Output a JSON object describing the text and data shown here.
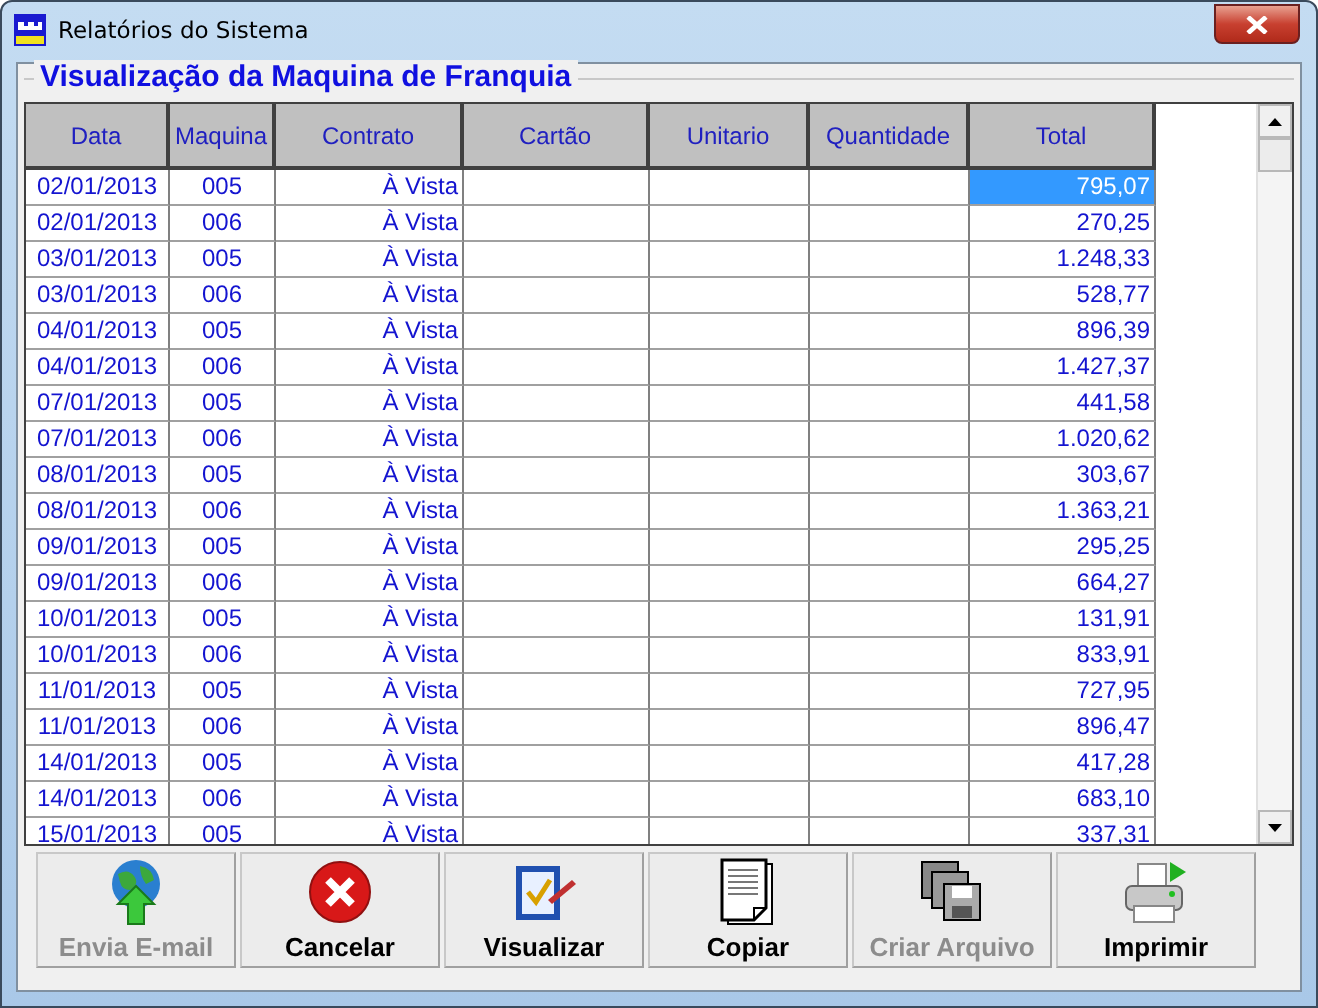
{
  "window": {
    "title": "Relatórios do Sistema"
  },
  "group": {
    "title": "Visualização da Maquina de Franquia"
  },
  "table": {
    "columns": [
      "Data",
      "Maquina",
      "Contrato",
      "Cartão",
      "Unitario",
      "Quantidade",
      "Total"
    ],
    "rows": [
      {
        "cells": [
          "02/01/2013",
          "005",
          "À Vista",
          "",
          "",
          "",
          "795,07"
        ],
        "selected": true
      },
      {
        "cells": [
          "02/01/2013",
          "006",
          "À Vista",
          "",
          "",
          "",
          "270,25"
        ],
        "selected": false
      },
      {
        "cells": [
          "03/01/2013",
          "005",
          "À Vista",
          "",
          "",
          "",
          "1.248,33"
        ],
        "selected": false
      },
      {
        "cells": [
          "03/01/2013",
          "006",
          "À Vista",
          "",
          "",
          "",
          "528,77"
        ],
        "selected": false
      },
      {
        "cells": [
          "04/01/2013",
          "005",
          "À Vista",
          "",
          "",
          "",
          "896,39"
        ],
        "selected": false
      },
      {
        "cells": [
          "04/01/2013",
          "006",
          "À Vista",
          "",
          "",
          "",
          "1.427,37"
        ],
        "selected": false
      },
      {
        "cells": [
          "07/01/2013",
          "005",
          "À Vista",
          "",
          "",
          "",
          "441,58"
        ],
        "selected": false
      },
      {
        "cells": [
          "07/01/2013",
          "006",
          "À Vista",
          "",
          "",
          "",
          "1.020,62"
        ],
        "selected": false
      },
      {
        "cells": [
          "08/01/2013",
          "005",
          "À Vista",
          "",
          "",
          "",
          "303,67"
        ],
        "selected": false
      },
      {
        "cells": [
          "08/01/2013",
          "006",
          "À Vista",
          "",
          "",
          "",
          "1.363,21"
        ],
        "selected": false
      },
      {
        "cells": [
          "09/01/2013",
          "005",
          "À Vista",
          "",
          "",
          "",
          "295,25"
        ],
        "selected": false
      },
      {
        "cells": [
          "09/01/2013",
          "006",
          "À Vista",
          "",
          "",
          "",
          "664,27"
        ],
        "selected": false
      },
      {
        "cells": [
          "10/01/2013",
          "005",
          "À Vista",
          "",
          "",
          "",
          "131,91"
        ],
        "selected": false
      },
      {
        "cells": [
          "10/01/2013",
          "006",
          "À Vista",
          "",
          "",
          "",
          "833,91"
        ],
        "selected": false
      },
      {
        "cells": [
          "11/01/2013",
          "005",
          "À Vista",
          "",
          "",
          "",
          "727,95"
        ],
        "selected": false
      },
      {
        "cells": [
          "11/01/2013",
          "006",
          "À Vista",
          "",
          "",
          "",
          "896,47"
        ],
        "selected": false
      },
      {
        "cells": [
          "14/01/2013",
          "005",
          "À Vista",
          "",
          "",
          "",
          "417,28"
        ],
        "selected": false
      },
      {
        "cells": [
          "14/01/2013",
          "006",
          "À Vista",
          "",
          "",
          "",
          "683,10"
        ],
        "selected": false
      },
      {
        "cells": [
          "15/01/2013",
          "005",
          "À Vista",
          "",
          "",
          "",
          "337,31"
        ],
        "selected": false
      }
    ]
  },
  "buttons": [
    {
      "label": "Envia E-mail",
      "kind": "email",
      "disabled": true
    },
    {
      "label": "Cancelar",
      "kind": "cancel",
      "disabled": false
    },
    {
      "label": "Visualizar",
      "kind": "preview",
      "disabled": false
    },
    {
      "label": "Copiar",
      "kind": "copy",
      "disabled": false
    },
    {
      "label": "Criar Arquivo",
      "kind": "file",
      "disabled": true
    },
    {
      "label": "Imprimir",
      "kind": "print",
      "disabled": false
    }
  ]
}
